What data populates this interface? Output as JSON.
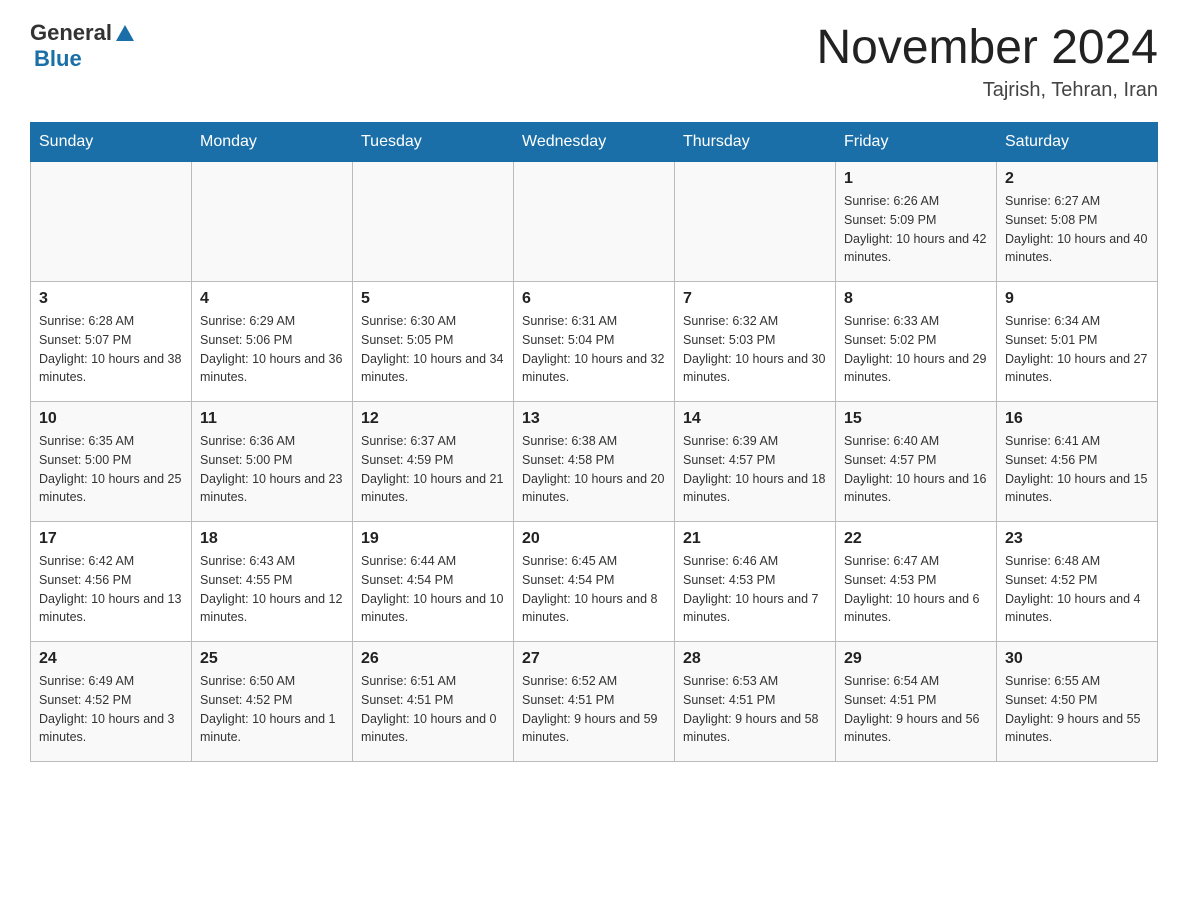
{
  "header": {
    "logo_general": "General",
    "logo_blue": "Blue",
    "month_year": "November 2024",
    "location": "Tajrish, Tehran, Iran"
  },
  "weekdays": [
    "Sunday",
    "Monday",
    "Tuesday",
    "Wednesday",
    "Thursday",
    "Friday",
    "Saturday"
  ],
  "weeks": [
    [
      {
        "day": "",
        "info": ""
      },
      {
        "day": "",
        "info": ""
      },
      {
        "day": "",
        "info": ""
      },
      {
        "day": "",
        "info": ""
      },
      {
        "day": "",
        "info": ""
      },
      {
        "day": "1",
        "info": "Sunrise: 6:26 AM\nSunset: 5:09 PM\nDaylight: 10 hours and 42 minutes."
      },
      {
        "day": "2",
        "info": "Sunrise: 6:27 AM\nSunset: 5:08 PM\nDaylight: 10 hours and 40 minutes."
      }
    ],
    [
      {
        "day": "3",
        "info": "Sunrise: 6:28 AM\nSunset: 5:07 PM\nDaylight: 10 hours and 38 minutes."
      },
      {
        "day": "4",
        "info": "Sunrise: 6:29 AM\nSunset: 5:06 PM\nDaylight: 10 hours and 36 minutes."
      },
      {
        "day": "5",
        "info": "Sunrise: 6:30 AM\nSunset: 5:05 PM\nDaylight: 10 hours and 34 minutes."
      },
      {
        "day": "6",
        "info": "Sunrise: 6:31 AM\nSunset: 5:04 PM\nDaylight: 10 hours and 32 minutes."
      },
      {
        "day": "7",
        "info": "Sunrise: 6:32 AM\nSunset: 5:03 PM\nDaylight: 10 hours and 30 minutes."
      },
      {
        "day": "8",
        "info": "Sunrise: 6:33 AM\nSunset: 5:02 PM\nDaylight: 10 hours and 29 minutes."
      },
      {
        "day": "9",
        "info": "Sunrise: 6:34 AM\nSunset: 5:01 PM\nDaylight: 10 hours and 27 minutes."
      }
    ],
    [
      {
        "day": "10",
        "info": "Sunrise: 6:35 AM\nSunset: 5:00 PM\nDaylight: 10 hours and 25 minutes."
      },
      {
        "day": "11",
        "info": "Sunrise: 6:36 AM\nSunset: 5:00 PM\nDaylight: 10 hours and 23 minutes."
      },
      {
        "day": "12",
        "info": "Sunrise: 6:37 AM\nSunset: 4:59 PM\nDaylight: 10 hours and 21 minutes."
      },
      {
        "day": "13",
        "info": "Sunrise: 6:38 AM\nSunset: 4:58 PM\nDaylight: 10 hours and 20 minutes."
      },
      {
        "day": "14",
        "info": "Sunrise: 6:39 AM\nSunset: 4:57 PM\nDaylight: 10 hours and 18 minutes."
      },
      {
        "day": "15",
        "info": "Sunrise: 6:40 AM\nSunset: 4:57 PM\nDaylight: 10 hours and 16 minutes."
      },
      {
        "day": "16",
        "info": "Sunrise: 6:41 AM\nSunset: 4:56 PM\nDaylight: 10 hours and 15 minutes."
      }
    ],
    [
      {
        "day": "17",
        "info": "Sunrise: 6:42 AM\nSunset: 4:56 PM\nDaylight: 10 hours and 13 minutes."
      },
      {
        "day": "18",
        "info": "Sunrise: 6:43 AM\nSunset: 4:55 PM\nDaylight: 10 hours and 12 minutes."
      },
      {
        "day": "19",
        "info": "Sunrise: 6:44 AM\nSunset: 4:54 PM\nDaylight: 10 hours and 10 minutes."
      },
      {
        "day": "20",
        "info": "Sunrise: 6:45 AM\nSunset: 4:54 PM\nDaylight: 10 hours and 8 minutes."
      },
      {
        "day": "21",
        "info": "Sunrise: 6:46 AM\nSunset: 4:53 PM\nDaylight: 10 hours and 7 minutes."
      },
      {
        "day": "22",
        "info": "Sunrise: 6:47 AM\nSunset: 4:53 PM\nDaylight: 10 hours and 6 minutes."
      },
      {
        "day": "23",
        "info": "Sunrise: 6:48 AM\nSunset: 4:52 PM\nDaylight: 10 hours and 4 minutes."
      }
    ],
    [
      {
        "day": "24",
        "info": "Sunrise: 6:49 AM\nSunset: 4:52 PM\nDaylight: 10 hours and 3 minutes."
      },
      {
        "day": "25",
        "info": "Sunrise: 6:50 AM\nSunset: 4:52 PM\nDaylight: 10 hours and 1 minute."
      },
      {
        "day": "26",
        "info": "Sunrise: 6:51 AM\nSunset: 4:51 PM\nDaylight: 10 hours and 0 minutes."
      },
      {
        "day": "27",
        "info": "Sunrise: 6:52 AM\nSunset: 4:51 PM\nDaylight: 9 hours and 59 minutes."
      },
      {
        "day": "28",
        "info": "Sunrise: 6:53 AM\nSunset: 4:51 PM\nDaylight: 9 hours and 58 minutes."
      },
      {
        "day": "29",
        "info": "Sunrise: 6:54 AM\nSunset: 4:51 PM\nDaylight: 9 hours and 56 minutes."
      },
      {
        "day": "30",
        "info": "Sunrise: 6:55 AM\nSunset: 4:50 PM\nDaylight: 9 hours and 55 minutes."
      }
    ]
  ]
}
